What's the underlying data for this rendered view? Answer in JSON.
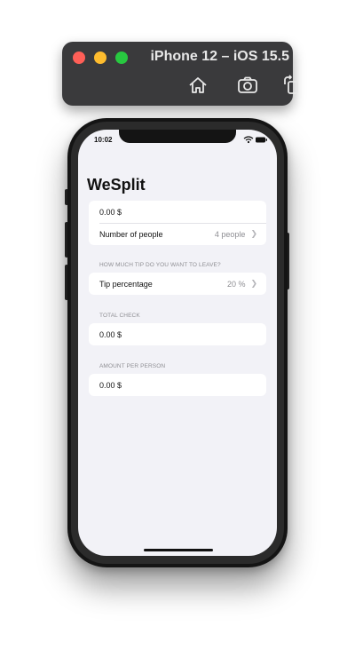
{
  "simulator": {
    "title": "iPhone 12 – iOS 15.5",
    "toolbar": [
      "home-icon",
      "screenshot-icon",
      "rotate-icon"
    ]
  },
  "status_bar": {
    "time": "10:02"
  },
  "app": {
    "title": "WeSplit",
    "amount_value": "0.00 $",
    "people": {
      "label": "Number of people",
      "value": "4 people"
    },
    "tip_section_header": "HOW MUCH TIP DO YOU WANT TO LEAVE?",
    "tip": {
      "label": "Tip percentage",
      "value": "20 %"
    },
    "total_header": "TOTAL CHECK",
    "total_value": "0.00 $",
    "per_person_header": "AMOUNT PER PERSON",
    "per_person_value": "0.00 $"
  },
  "colors": {
    "background": "#f2f2f7",
    "card": "#ffffff",
    "secondary_text": "#8e8e93"
  }
}
